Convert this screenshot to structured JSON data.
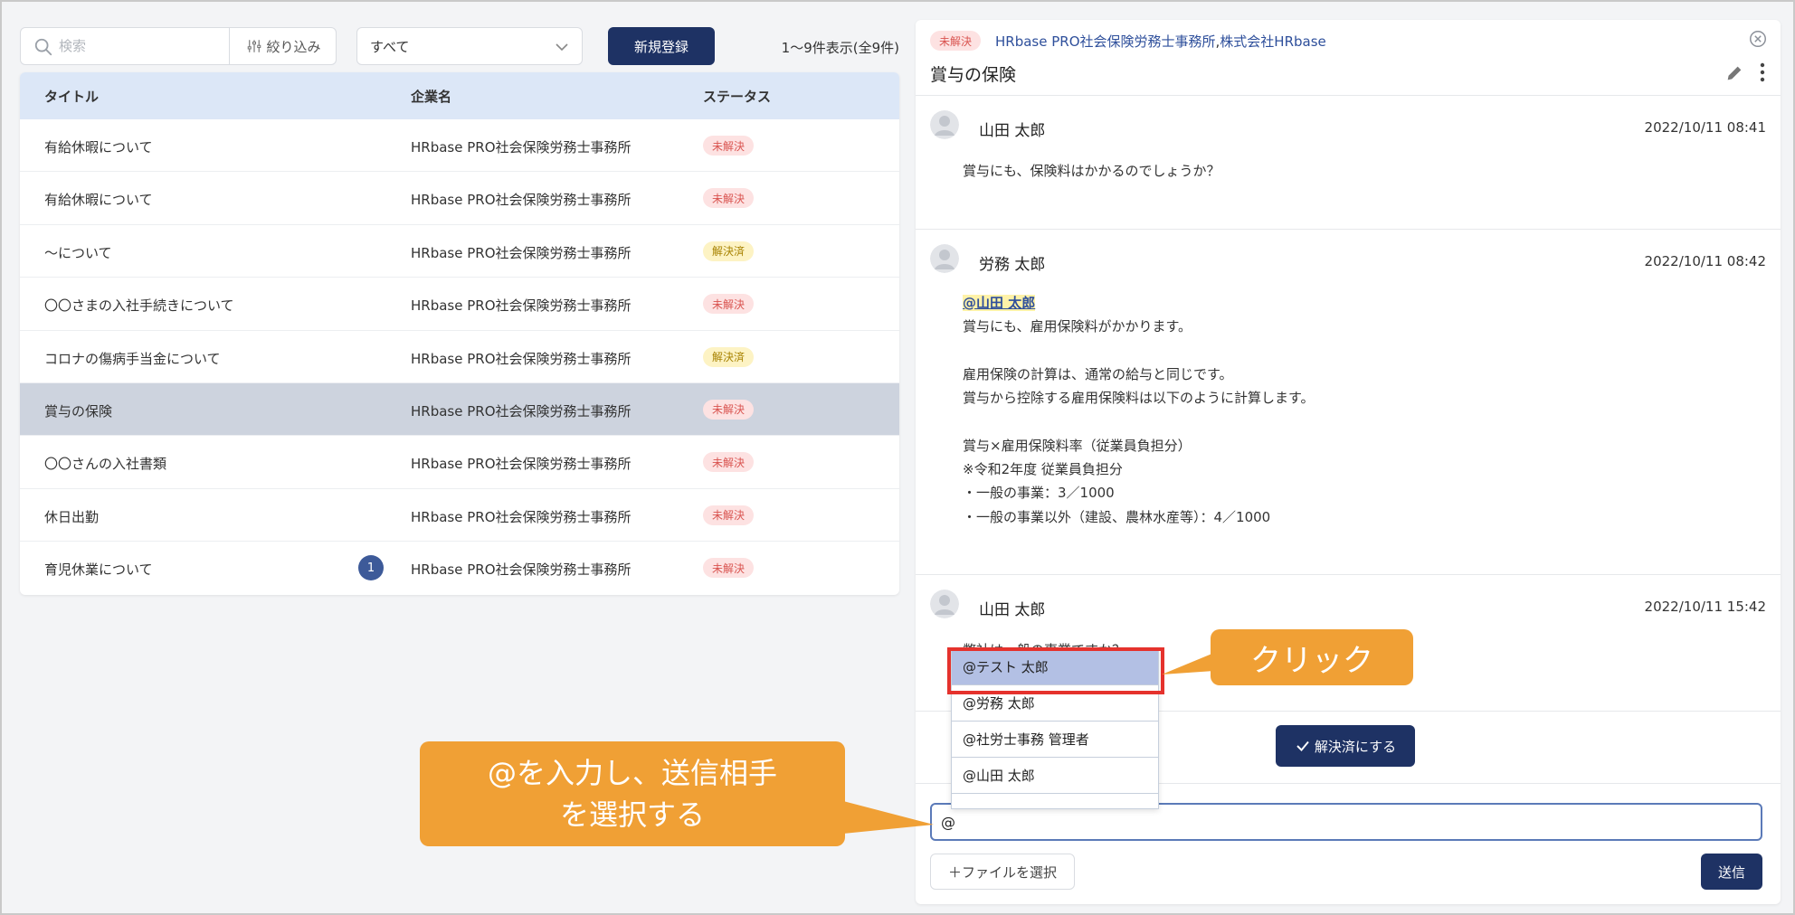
{
  "toolbar": {
    "search_placeholder": "検索",
    "filter_label": "絞り込み",
    "status_select_value": "すべて",
    "new_button_label": "新規登録",
    "count_text": "1～9件表示(全9件)"
  },
  "table": {
    "headers": {
      "title": "タイトル",
      "company": "企業名",
      "status": "ステータス"
    },
    "rows": [
      {
        "title": "有給休暇について",
        "company": "HRbase PRO社会保険労務士事務所",
        "status": "未解決"
      },
      {
        "title": "有給休暇について",
        "company": "HRbase PRO社会保険労務士事務所",
        "status": "未解決"
      },
      {
        "title": "〜について",
        "company": "HRbase PRO社会保険労務士事務所",
        "status": "解決済"
      },
      {
        "title": "〇〇さまの入社手続きについて",
        "company": "HRbase PRO社会保険労務士事務所",
        "status": "未解決"
      },
      {
        "title": "コロナの傷病手当金について",
        "company": "HRbase PRO社会保険労務士事務所",
        "status": "解決済"
      },
      {
        "title": "賞与の保険",
        "company": "HRbase PRO社会保険労務士事務所",
        "status": "未解決"
      },
      {
        "title": "〇〇さんの入社書類",
        "company": "HRbase PRO社会保険労務士事務所",
        "status": "未解決"
      },
      {
        "title": "休日出勤",
        "company": "HRbase PRO社会保険労務士事務所",
        "status": "未解決"
      },
      {
        "title": "育児休業について",
        "company": "HRbase PRO社会保険労務士事務所",
        "status": "未解決",
        "unread": "1"
      }
    ]
  },
  "detail": {
    "status_badge": "未解決",
    "company_1": "HRbase PRO社会保険労務士事務所",
    "company_sep": ",",
    "company_2": "株式会社HRbase",
    "title": "賞与の保険",
    "messages": [
      {
        "author": "山田 太郎",
        "time": "2022/10/11 08:41",
        "lines": [
          "賞与にも、保険料はかかるのでしょうか？"
        ]
      },
      {
        "author": "労務 太郎",
        "time": "2022/10/11 08:42",
        "mention": "@山田 太郎",
        "lines": [
          "賞与にも、雇用保険料がかかります。",
          "",
          "雇用保険の計算は、通常の給与と同じです。",
          "賞与から控除する雇用保険料は以下のように計算します。",
          "",
          "賞与×雇用保険料率（従業員負担分）",
          "※令和2年度 従業員負担分",
          "・一般の事業：3／1000",
          "・一般の事業以外（建設、農林水産等）：4／1000"
        ]
      },
      {
        "author": "山田 太郎",
        "time": "2022/10/11 15:42",
        "lines": [
          "弊社は一般の事業ですか？"
        ]
      }
    ],
    "resolve_button_label": "解決済にする",
    "input_value": "@",
    "file_button_label": "＋ファイルを選択",
    "send_button_label": "送信"
  },
  "mention_dropdown": {
    "options": [
      "@テスト 太郎",
      "@労務 太郎",
      "@社労士事務 管理者",
      "@山田 太郎"
    ]
  },
  "callouts": {
    "click": "クリック",
    "input_line1": "@を入力し、送信相手",
    "input_line2": "を選択する"
  },
  "colors": {
    "primary": "#1e3264",
    "header_bg": "#dce7f7",
    "selected_row": "#cdd3de",
    "unresolved_bg": "#fde2e2",
    "unresolved_text": "#d9534f",
    "resolved_bg": "#fdf3c4",
    "resolved_text": "#a78200",
    "callout": "#f0a035",
    "highlight": "#e5322d"
  }
}
